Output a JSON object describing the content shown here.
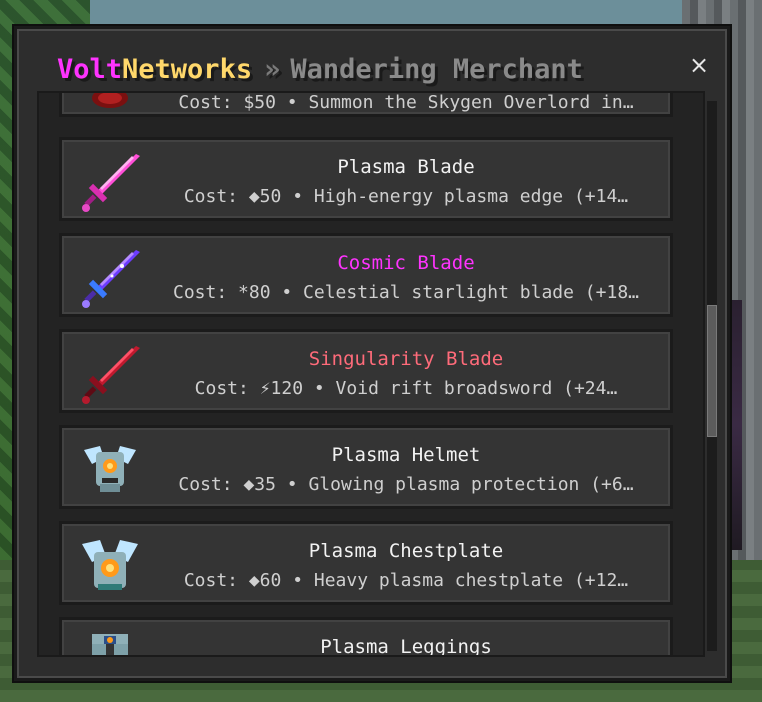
{
  "header": {
    "brand_part1": "Volt",
    "brand_part2": "Networks",
    "separator": "»",
    "breadcrumb": "Wandering Merchant",
    "close_label": "×"
  },
  "items": [
    {
      "name": "",
      "desc": "Cost: $50 • Summon the Skygen Overlord in…",
      "icon": "overlord-egg-icon"
    },
    {
      "name": "Plasma Blade",
      "desc": "Cost: ◆50 • High-energy plasma edge (+14…",
      "icon": "plasma-blade-sword-icon",
      "name_color": "#f2f2f2"
    },
    {
      "name": "Cosmic Blade",
      "desc": "Cost: *80 • Celestial starlight blade (+18…",
      "icon": "cosmic-blade-sword-icon",
      "name_color": "#ff33ff"
    },
    {
      "name": "Singularity Blade",
      "desc": "Cost: ⚡120 • Void rift broadsword (+24…",
      "icon": "singularity-blade-sword-icon",
      "name_color": "#ff6b7a"
    },
    {
      "name": "Plasma Helmet",
      "desc": "Cost: ◆35 • Glowing plasma protection (+6…",
      "icon": "plasma-helmet-icon",
      "name_color": "#f2f2f2"
    },
    {
      "name": "Plasma Chestplate",
      "desc": "Cost: ◆60 • Heavy plasma chestplate (+12…",
      "icon": "plasma-chestplate-icon",
      "name_color": "#f2f2f2"
    },
    {
      "name": "Plasma Leggings",
      "desc": "",
      "icon": "plasma-leggings-icon",
      "name_color": "#f2f2f2"
    }
  ],
  "colors": {
    "brand_magenta": "#ff33ff",
    "brand_gold": "#ffd86b",
    "cosmic": "#ff33ff",
    "singularity": "#ff6b7a"
  }
}
